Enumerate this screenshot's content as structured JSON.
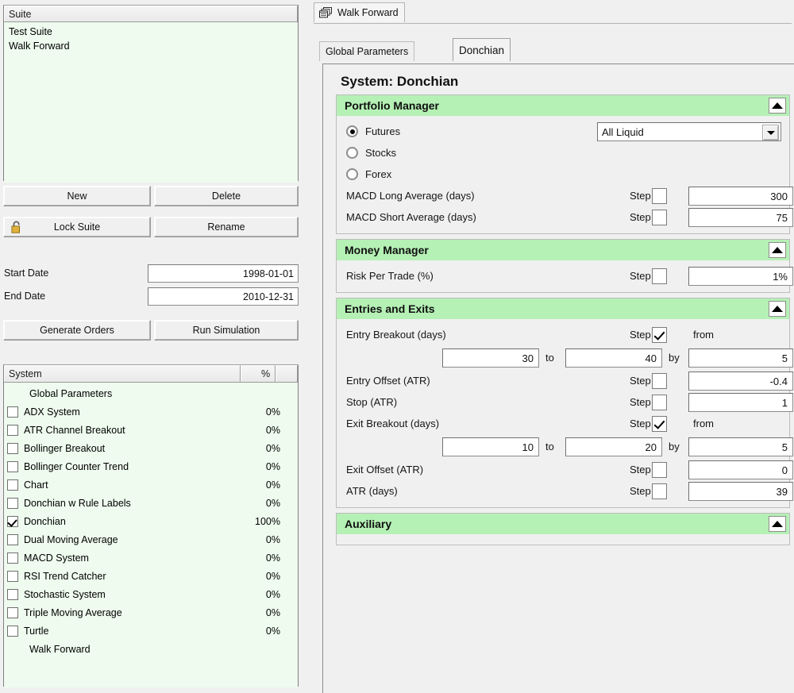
{
  "left": {
    "suite_panel": {
      "header": "Suite",
      "items": [
        "Test Suite",
        "Walk Forward"
      ]
    },
    "buttons": {
      "new": "New",
      "delete": "Delete",
      "lock_suite": "Lock Suite",
      "rename": "Rename",
      "generate_orders": "Generate Orders",
      "run_simulation": "Run Simulation"
    },
    "dates": {
      "start_label": "Start Date",
      "start_value": "1998-01-01",
      "end_label": "End Date",
      "end_value": "2010-12-31"
    },
    "system_list": {
      "col_name": "System",
      "col_pct": "%",
      "rows": [
        {
          "label": "Global Parameters",
          "pct": "",
          "checkbox": false,
          "checked": false
        },
        {
          "label": "ADX System",
          "pct": "0%",
          "checkbox": true,
          "checked": false
        },
        {
          "label": "ATR Channel Breakout",
          "pct": "0%",
          "checkbox": true,
          "checked": false
        },
        {
          "label": "Bollinger Breakout",
          "pct": "0%",
          "checkbox": true,
          "checked": false
        },
        {
          "label": "Bollinger Counter Trend",
          "pct": "0%",
          "checkbox": true,
          "checked": false
        },
        {
          "label": "Chart",
          "pct": "0%",
          "checkbox": true,
          "checked": false
        },
        {
          "label": "Donchian w Rule Labels",
          "pct": "0%",
          "checkbox": true,
          "checked": false
        },
        {
          "label": "Donchian",
          "pct": "100%",
          "checkbox": true,
          "checked": true
        },
        {
          "label": "Dual Moving Average",
          "pct": "0%",
          "checkbox": true,
          "checked": false
        },
        {
          "label": "MACD System",
          "pct": "0%",
          "checkbox": true,
          "checked": false
        },
        {
          "label": "RSI Trend Catcher",
          "pct": "0%",
          "checkbox": true,
          "checked": false
        },
        {
          "label": "Stochastic System",
          "pct": "0%",
          "checkbox": true,
          "checked": false
        },
        {
          "label": "Triple Moving Average",
          "pct": "0%",
          "checkbox": true,
          "checked": false
        },
        {
          "label": "Turtle",
          "pct": "0%",
          "checkbox": true,
          "checked": false
        },
        {
          "label": "Walk Forward",
          "pct": "",
          "checkbox": false,
          "checked": false
        }
      ]
    }
  },
  "right": {
    "outer_tab": "Walk Forward",
    "inner_tabs": {
      "global": "Global Parameters",
      "donchian": "Donchian"
    },
    "page_title": "System: Donchian",
    "sections": [
      {
        "title": "Portfolio Manager",
        "radios": [
          {
            "label": "Futures",
            "selected": true
          },
          {
            "label": "Stocks",
            "selected": false
          },
          {
            "label": "Forex",
            "selected": false
          }
        ],
        "combo_value": "All Liquid",
        "params": [
          {
            "label": "MACD Long Average (days)",
            "step_word": "Step",
            "step_checked": false,
            "value": "300"
          },
          {
            "label": "MACD Short Average (days)",
            "step_word": "Step",
            "step_checked": false,
            "value": "75"
          }
        ]
      },
      {
        "title": "Money Manager",
        "params": [
          {
            "label": "Risk Per Trade (%)",
            "step_word": "Step",
            "step_checked": false,
            "value": "1%"
          }
        ]
      },
      {
        "title": "Entries and Exits",
        "params": [
          {
            "label": "Entry Breakout (days)",
            "step_word": "Step",
            "step_checked": true,
            "range": {
              "from_word": "from",
              "from": "30",
              "to_word": "to",
              "to": "40",
              "by_word": "by",
              "by": "5"
            }
          },
          {
            "label": "Entry Offset (ATR)",
            "step_word": "Step",
            "step_checked": false,
            "value": "-0.4"
          },
          {
            "label": "Stop (ATR)",
            "step_word": "Step",
            "step_checked": false,
            "value": "1"
          },
          {
            "label": "Exit Breakout (days)",
            "step_word": "Step",
            "step_checked": true,
            "range": {
              "from_word": "from",
              "from": "10",
              "to_word": "to",
              "to": "20",
              "by_word": "by",
              "by": "5"
            }
          },
          {
            "label": "Exit Offset (ATR)",
            "step_word": "Step",
            "step_checked": false,
            "value": "0"
          },
          {
            "label": "ATR (days)",
            "step_word": "Step",
            "step_checked": false,
            "value": "39"
          }
        ]
      },
      {
        "title": "Auxiliary",
        "params": []
      }
    ]
  },
  "colors": {
    "section_header_green": "#b5f0b5",
    "list_background_green": "#eefbee",
    "window_gray": "#f0f0f0",
    "accent_text": "#101010"
  },
  "icons": {
    "lock": "padlock-open-icon",
    "window": "cascade-windows-icon",
    "collapse": "triangle-up-icon",
    "dropdown": "triangle-down-icon"
  }
}
